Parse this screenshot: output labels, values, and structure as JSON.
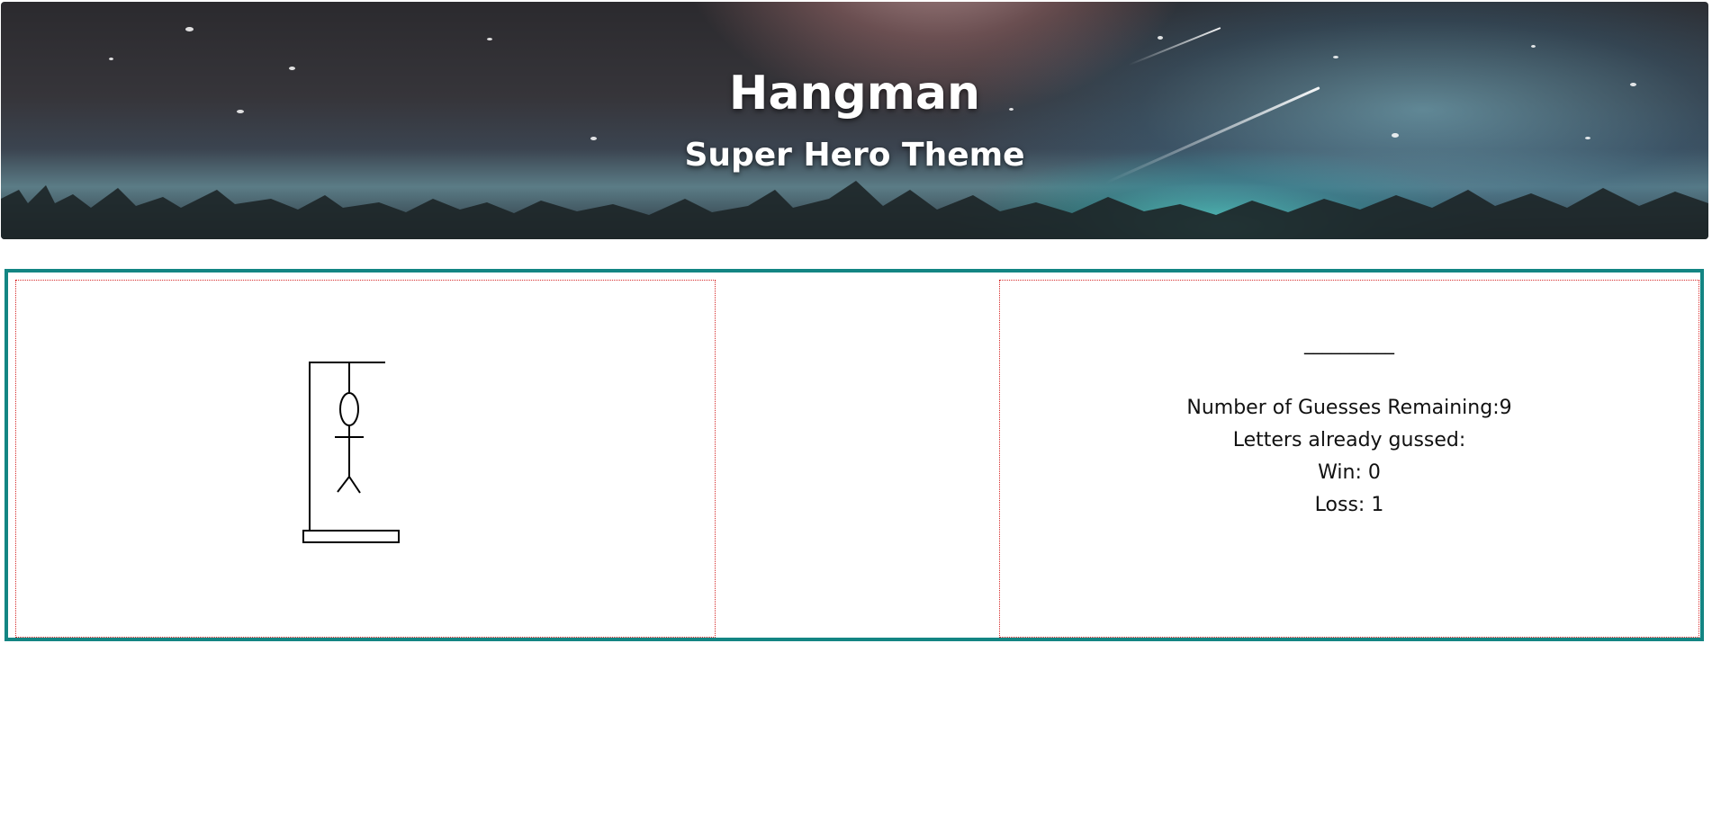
{
  "header": {
    "title": "Hangman",
    "subtitle": "Super Hero Theme"
  },
  "game": {
    "word_display": "__________",
    "guesses_remaining_label": "Number of Guesses Remaining:",
    "guesses_remaining": "9",
    "letters_guessed_label": "Letters already gussed:",
    "letters_guessed": "",
    "wins_label": "Win: ",
    "wins": "0",
    "losses_label": "Loss: ",
    "losses": "1"
  },
  "colors": {
    "container_border": "#138583",
    "panel_border": "#d62a2a"
  },
  "icons": {
    "hangman_drawing": "hangman-figure-icon"
  }
}
